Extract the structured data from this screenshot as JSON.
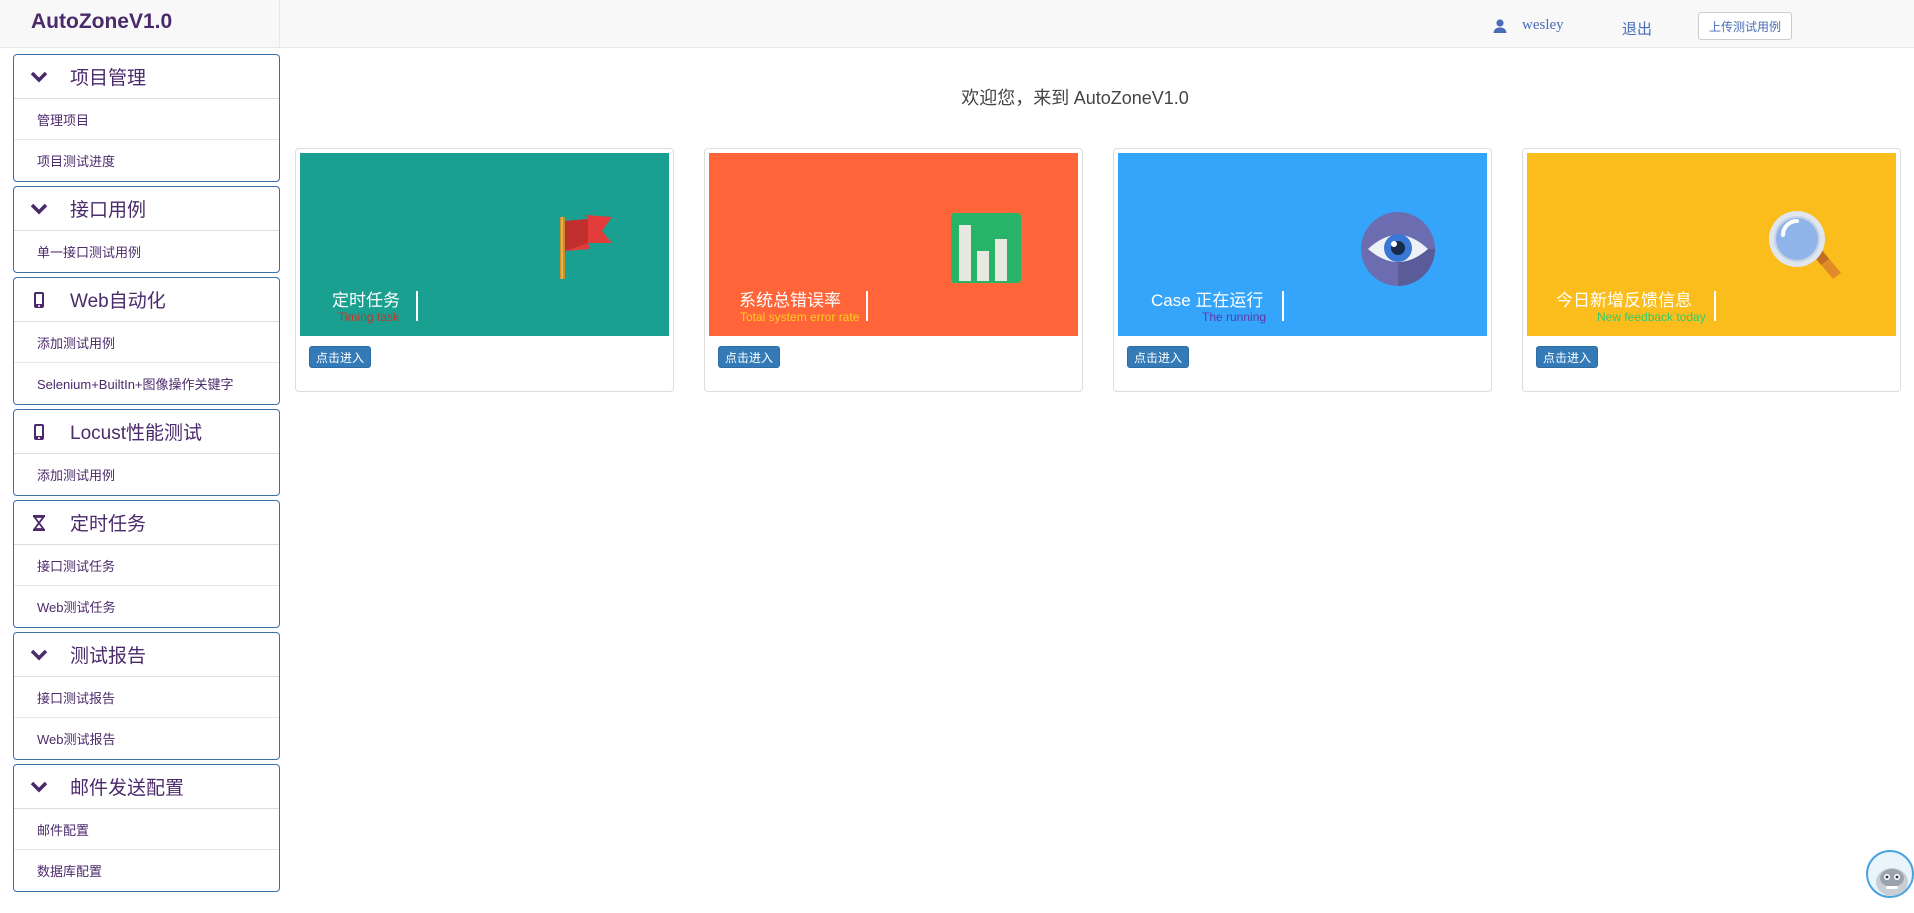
{
  "header": {
    "brand": "AutoZoneV1.0",
    "user_name": "wesley",
    "logout": "退出",
    "upload_button": "上传测试用例"
  },
  "sidebar": {
    "groups": [
      {
        "title": "项目管理",
        "icon": "chevron-down-icon",
        "items": [
          "管理项目",
          "项目测试进度"
        ]
      },
      {
        "title": "接口用例",
        "icon": "chevron-down-icon",
        "items": [
          "单一接口测试用例"
        ]
      },
      {
        "title": "Web自动化",
        "icon": "mobile-icon",
        "items": [
          "添加测试用例",
          "Selenium+BuiltIn+图像操作关键字"
        ]
      },
      {
        "title": "Locust性能测试",
        "icon": "mobile-icon",
        "items": [
          "添加测试用例"
        ]
      },
      {
        "title": "定时任务",
        "icon": "hourglass-icon",
        "items": [
          "接口测试任务",
          "Web测试任务"
        ]
      },
      {
        "title": "测试报告",
        "icon": "chevron-down-icon",
        "items": [
          "接口测试报告",
          "Web测试报告"
        ]
      },
      {
        "title": "邮件发送配置",
        "icon": "chevron-down-icon",
        "items": [
          "邮件配置",
          "数据库配置"
        ]
      }
    ]
  },
  "main": {
    "welcome_prefix": "欢迎您，来到 ",
    "welcome_app": "AutoZoneV1.0",
    "cards": [
      {
        "title": "定时任务",
        "subtitle": "Timing task",
        "bg": "#1aa090",
        "sub_color": "#c0392b",
        "icon": "flag-icon",
        "button": "点击进入"
      },
      {
        "title": "系统总错误率",
        "subtitle": "Total system error rate",
        "bg": "#ff6538",
        "sub_color": "#f6d21c",
        "icon": "bar-chart-icon",
        "button": "点击进入"
      },
      {
        "title": "Case 正在运行",
        "subtitle": "The running",
        "bg": "#35a5fb",
        "sub_color": "#5b3aa6",
        "icon": "eye-icon",
        "button": "点击进入"
      },
      {
        "title": "今日新增反馈信息",
        "subtitle": "New feedback today",
        "bg": "#fbbd1c",
        "sub_color": "#2ecc71",
        "icon": "magnifier-icon",
        "button": "点击进入"
      }
    ]
  },
  "colors": {
    "accent_purple": "#4b2a6b",
    "link_blue": "#4a6db8",
    "button_blue": "#337ab7",
    "sidebar_border": "#3a6fa8"
  }
}
